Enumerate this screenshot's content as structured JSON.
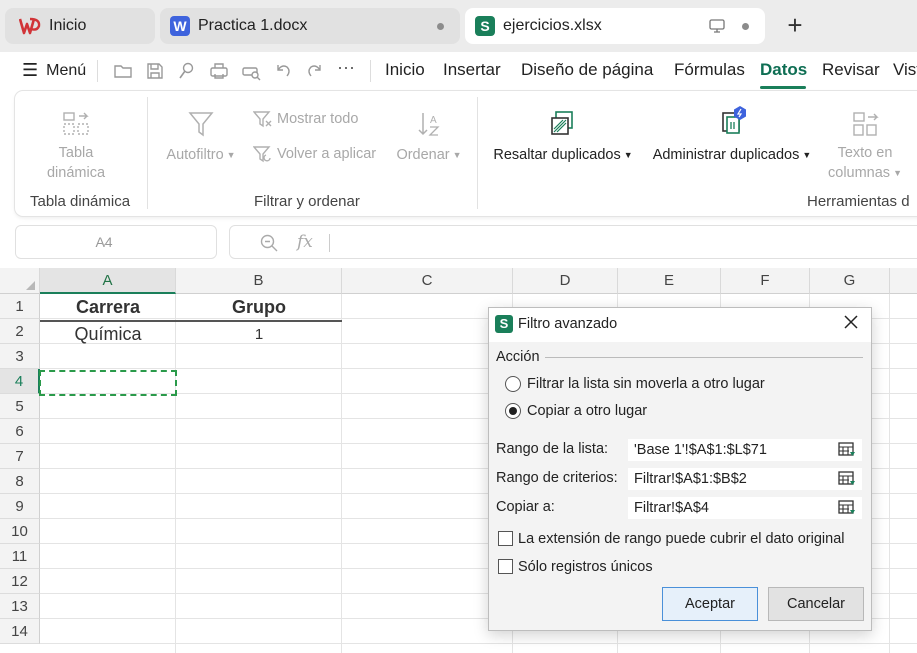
{
  "tabs": [
    {
      "label": "Inicio",
      "logo": "W",
      "logo_color": "#d13438"
    },
    {
      "label": "Practica 1.docx",
      "logo": "W",
      "logo_color": "#3e63dd"
    },
    {
      "label": "ejercicios.xlsx",
      "logo": "S",
      "logo_color": "#1a7f5a"
    }
  ],
  "new_tab": "+",
  "menu": {
    "label": "Menú",
    "tabs": [
      "Inicio",
      "Insertar",
      "Diseño de página",
      "Fórmulas",
      "Datos",
      "Revisar",
      "Vist"
    ],
    "active": "Datos"
  },
  "ribbon": {
    "pivot": {
      "line1": "Tabla",
      "line2": "dinámica",
      "group": "Tabla dinámica"
    },
    "filter": {
      "autofilter": "Autofiltro",
      "show_all": "Mostrar todo",
      "reapply": "Volver a aplicar",
      "sort": "Ordenar",
      "group": "Filtrar y ordenar"
    },
    "tools": {
      "highlight_dup": "Resaltar duplicados",
      "manage_dup": "Administrar duplicados",
      "text_cols_1": "Texto en",
      "text_cols_2": "columnas",
      "group": "Herramientas d"
    }
  },
  "formula_bar": {
    "name_box": "A4",
    "fx": "fx"
  },
  "sheet": {
    "columns": [
      "A",
      "B",
      "C",
      "D",
      "E",
      "F",
      "G"
    ],
    "rows": [
      "1",
      "2",
      "3",
      "4",
      "5",
      "6",
      "7",
      "8",
      "9",
      "10",
      "11",
      "12",
      "13",
      "14"
    ],
    "selected_column": "A",
    "selected_row": "4",
    "cells": {
      "A1": "Carrera",
      "B1": "Grupo",
      "A2": "Química",
      "B2": "1"
    }
  },
  "dialog": {
    "title": "Filtro avanzado",
    "action_label": "Acción",
    "option_inplace": "Filtrar la lista sin moverla a otro lugar",
    "option_copy": "Copiar a otro lugar",
    "selected_option": "copy",
    "list_range_label": "Rango de la lista:",
    "list_range_value": "'Base 1'!$A$1:$L$71",
    "criteria_label": "Rango de criterios:",
    "criteria_value": "Filtrar!$A$1:$B$2",
    "copy_to_label": "Copiar a:",
    "copy_to_value": "Filtrar!$A$4",
    "expand_range_label": "La extensión de rango puede cubrir el dato original",
    "expand_range_checked": false,
    "unique_label": "Sólo registros únicos",
    "unique_checked": false,
    "ok": "Aceptar",
    "cancel": "Cancelar"
  }
}
